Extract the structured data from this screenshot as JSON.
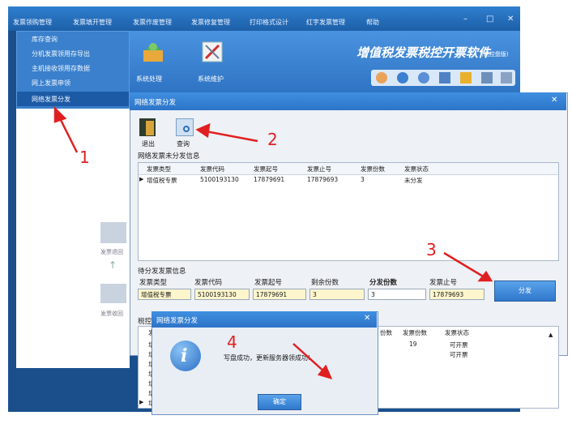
{
  "menubar": {
    "items": [
      "发票领购管理",
      "发票填开管理",
      "发票作废管理",
      "发票修复管理",
      "打印格式设计",
      "红字发票管理",
      "帮助"
    ]
  },
  "dropdown": {
    "items": [
      "库存查询",
      "分机发票领用存导出",
      "主机接收领用存数据",
      "网上发票申领",
      "网络发票分发"
    ],
    "selected_index": 4
  },
  "ribbon": {
    "app_title": "增值税发票税控开票软件",
    "app_subtitle": "(税控盘版)",
    "system_handle_label": "系统处理",
    "system_maintain_label": "系统维护"
  },
  "background_labels": {
    "b1": "发票退回",
    "b2": "发票收回"
  },
  "dialog": {
    "title": "网络发票分发",
    "toolbar": {
      "exit": "退出",
      "query": "查询"
    },
    "unassigned": {
      "title": "网络发票未分发信息",
      "columns": [
        "发票类型",
        "发票代码",
        "发票起号",
        "发票止号",
        "发票份数",
        "发票状态"
      ],
      "rows": [
        [
          "增值税专票",
          "5100193130",
          "17879691",
          "17879693",
          "3",
          "未分发"
        ]
      ]
    },
    "pending": {
      "title": "待分发发票信息",
      "labels": [
        "发票类型",
        "发票代码",
        "发票起号",
        "剩余份数",
        "分发份数",
        "发票止号"
      ],
      "values": [
        "增值税专票",
        "5100193130",
        "17879691",
        "3",
        "3",
        "17879693"
      ],
      "button": "分发"
    },
    "branch": {
      "title_partial": "税控",
      "visible_col_left": "发",
      "row_prefix": "增",
      "columns": [
        "份数",
        "发票份数",
        "发票状态"
      ],
      "rows": [
        [
          "",
          "19",
          "可开票"
        ],
        [
          "",
          "",
          "可开票"
        ]
      ]
    }
  },
  "message_box": {
    "title": "网络发票分发",
    "text": "写盘成功，更新服务器领成功!",
    "ok_label": "确定"
  },
  "annotations": [
    "1",
    "2",
    "3",
    "4"
  ],
  "colors": {
    "annotation": "#e02020",
    "titlebar": "#2d74c8",
    "yellow_field": "#fdf6cc"
  }
}
